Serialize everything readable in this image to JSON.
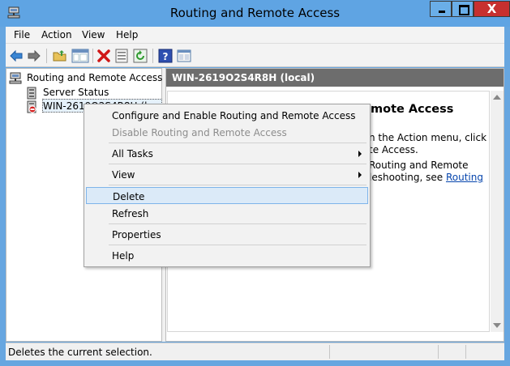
{
  "window": {
    "title": "Routing and Remote Access",
    "close_glyph": "X"
  },
  "menubar": {
    "items": [
      "File",
      "Action",
      "View",
      "Help"
    ]
  },
  "toolbar": {
    "icons": [
      "back-arrow-icon",
      "forward-arrow-icon",
      "up-folder-icon",
      "show-hide-tree-icon",
      "delete-icon",
      "properties-icon",
      "refresh-icon",
      "help-icon",
      "console-view-icon"
    ]
  },
  "tree": {
    "root_label": "Routing and Remote Access",
    "server_status_label": "Server Status",
    "server_label": "WIN-2619O2S4R8H (local)"
  },
  "right_pane": {
    "header": "WIN-2619O2S4R8H (local)",
    "welcome_title": "mote Access",
    "line1": "n the Action menu, click",
    "line2": "te Access.",
    "line3": "Routing and Remote",
    "line4_prefix": "leshooting, see ",
    "line4_link": "Routing"
  },
  "context_menu": {
    "configure": "Configure and Enable Routing and Remote Access",
    "disable": "Disable Routing and Remote Access",
    "all_tasks": "All Tasks",
    "view": "View",
    "delete": "Delete",
    "refresh": "Refresh",
    "properties": "Properties",
    "help": "Help"
  },
  "statusbar": {
    "text": "Deletes the current selection."
  },
  "colors": {
    "title_bar": "#5fa4e3",
    "close_button": "#c7302f",
    "header_gray": "#6d6d6d",
    "link": "#0645ad",
    "hover": "#dbeaf8"
  }
}
